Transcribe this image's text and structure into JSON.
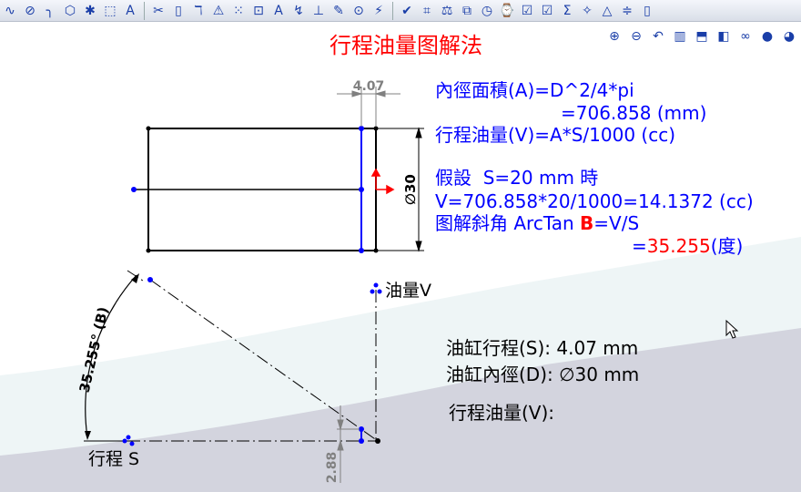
{
  "toolbar": {
    "row1": [
      {
        "name": "spline-icon",
        "glyph": "∿"
      },
      {
        "name": "ellipse-icon",
        "glyph": "⊘"
      },
      {
        "name": "fillet-icon",
        "glyph": "╮"
      },
      {
        "name": "polygon-icon",
        "glyph": "⬡"
      },
      {
        "name": "point-icon",
        "glyph": "✱"
      },
      {
        "name": "construction-geometry-icon",
        "glyph": "⬚"
      },
      {
        "name": "text-icon",
        "glyph": "A"
      },
      {
        "name": "trim-icon",
        "glyph": "✂"
      },
      {
        "name": "convert-entities-icon",
        "glyph": "▯"
      },
      {
        "name": "offset-icon",
        "glyph": "ℸ"
      },
      {
        "name": "mirror-icon",
        "glyph": "⚠"
      },
      {
        "name": "linear-pattern-icon",
        "glyph": "⁙"
      },
      {
        "name": "move-entities-icon",
        "glyph": "⊡"
      },
      {
        "name": "annotation-text-icon",
        "glyph": "A"
      },
      {
        "name": "relations-icon",
        "glyph": "↯"
      },
      {
        "name": "smart-dimension-icon",
        "glyph": "⊥"
      },
      {
        "name": "sketch-pencil-icon",
        "glyph": "✎"
      },
      {
        "name": "block-icon",
        "glyph": "⊙"
      },
      {
        "name": "rapid-sketch-icon",
        "glyph": "⚡"
      },
      {
        "name": "spell-check-icon",
        "glyph": "✔"
      },
      {
        "name": "measure-icon",
        "glyph": "⌗"
      },
      {
        "name": "mass-properties-icon",
        "glyph": "⚖"
      },
      {
        "name": "section-properties-icon",
        "glyph": "⧉"
      },
      {
        "name": "performance-icon",
        "glyph": "◷"
      },
      {
        "name": "simulation-icon",
        "glyph": "⌚"
      },
      {
        "name": "check-icon",
        "glyph": "☑"
      },
      {
        "name": "check2-icon",
        "glyph": "☑"
      },
      {
        "name": "equations-icon",
        "glyph": "Σ"
      },
      {
        "name": "deviation-icon",
        "glyph": "✧"
      },
      {
        "name": "draft-icon",
        "glyph": "△"
      },
      {
        "name": "thickness-icon",
        "glyph": "≑"
      },
      {
        "name": "more-icon",
        "glyph": "▯"
      }
    ],
    "row2": [
      {
        "name": "zoom-to-fit-icon",
        "glyph": "⊕"
      },
      {
        "name": "zoom-area-icon",
        "glyph": "⊖"
      },
      {
        "name": "previous-view-icon",
        "glyph": "↶"
      },
      {
        "name": "section-view-icon",
        "glyph": "▥"
      },
      {
        "name": "view-orientation-icon",
        "glyph": "⬒"
      },
      {
        "name": "display-style-icon",
        "glyph": "◧"
      },
      {
        "name": "hide-show-icon",
        "glyph": "∞"
      },
      {
        "name": "appearance-icon",
        "glyph": "●"
      },
      {
        "name": "scene-icon",
        "glyph": "◕"
      }
    ]
  },
  "title": "行程油量图解法",
  "formulas": {
    "line1": "內徑面積(A)=D^2/4*pi",
    "line2": "=706.858 (mm)",
    "line3": "行程油量(V)=A*S/1000 (cc)",
    "line4": "假設  S=20 mm 時",
    "line5": "V=706.858*20/1000=14.1372 (cc)",
    "line6_prefix": "图解斜角 ArcTan ",
    "line6_b": "B",
    "line6_suffix": "=V/S",
    "line7_eq": "=",
    "line7_value": "35.255",
    "line7_unit": "(度)"
  },
  "dimensions": {
    "stroke": "4.07",
    "diameter": "∅30",
    "angle": "35.255° (B)",
    "offset": "2.88"
  },
  "labels": {
    "volume_axis": "油量V",
    "stroke_axis": "行程 S"
  },
  "info": {
    "stroke": "油缸行程(S): 4.07 mm",
    "bore": "油缸內徑(D):  ∅30 mm",
    "volume": "行程油量(V):"
  },
  "colors": {
    "title": "#ff0000",
    "formula": "#0000ff",
    "sketch_blue": "#0000ff",
    "dim_gray": "#808080"
  }
}
